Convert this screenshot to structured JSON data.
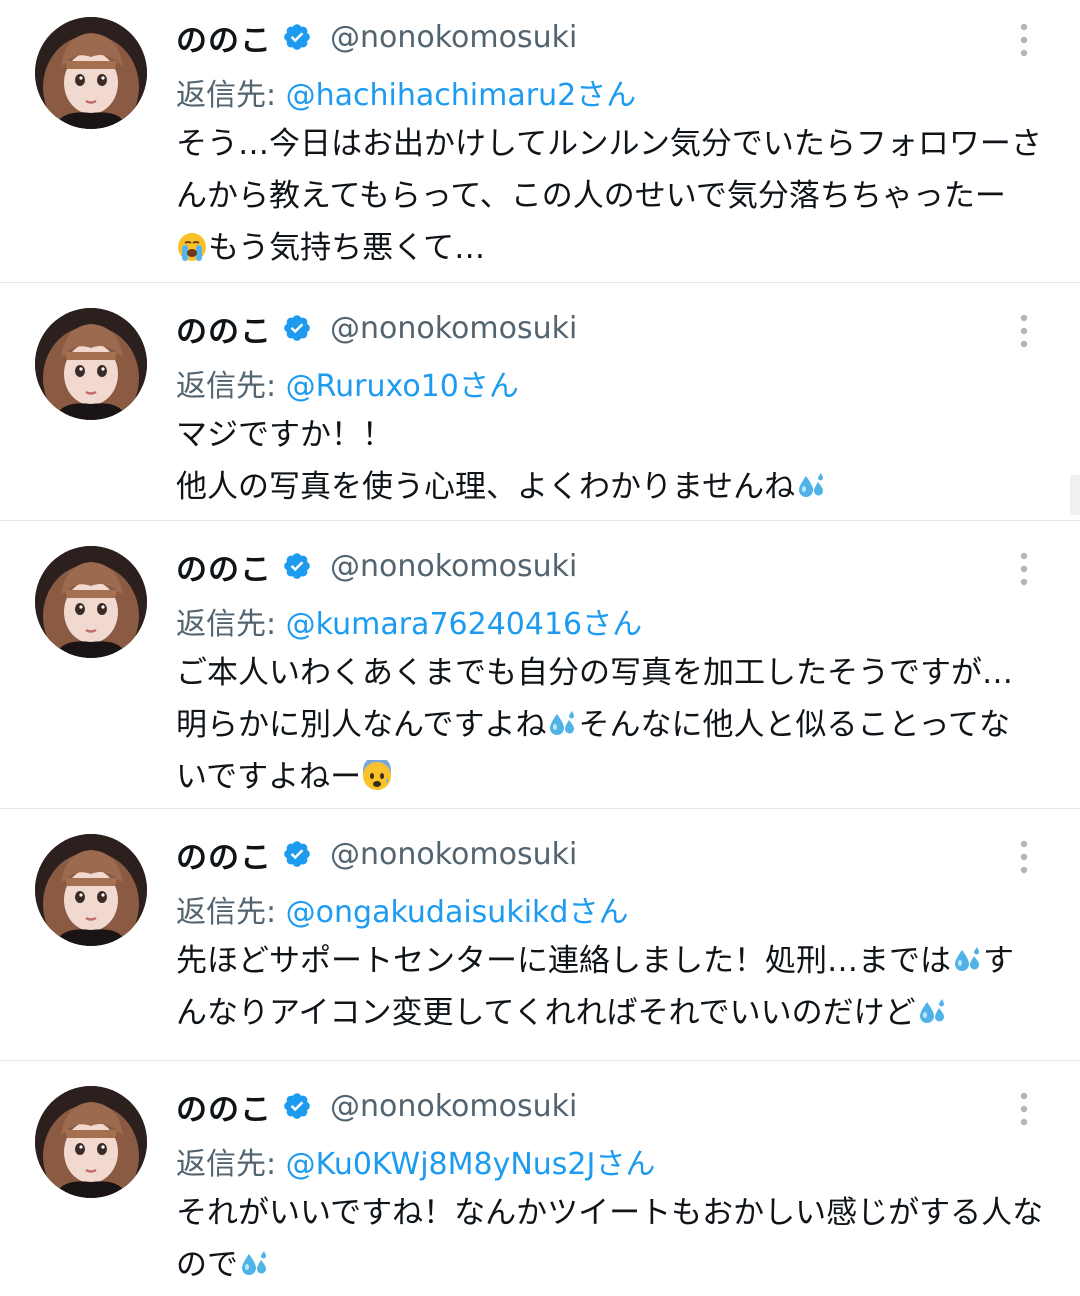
{
  "tweets": [
    {
      "display_name": "ののこ",
      "handle": "@nonokomosuki",
      "reply_prefix": "返信先: ",
      "reply_to": "@hachihachimaru2さん",
      "lines": [
        {
          "text": "そう…今日はお出かけしてルンルン気分でいたらフォロワーさ",
          "emoji": ""
        },
        {
          "text": "んから教えてもらって、この人のせいで気分落ちちゃったー",
          "emoji": ""
        },
        {
          "text": "もう気持ち悪くて…",
          "emoji": "crying-face-emoji",
          "emoji_pos": "start"
        }
      ]
    },
    {
      "display_name": "ののこ",
      "handle": "@nonokomosuki",
      "reply_prefix": "返信先: ",
      "reply_to": "@Ruruxo10さん",
      "lines": [
        {
          "text": "マジですか！！",
          "emoji": ""
        },
        {
          "text": "他人の写真を使う心理、よくわかりませんね",
          "emoji": "sweat-droplets-emoji",
          "emoji_pos": "end"
        }
      ]
    },
    {
      "display_name": "ののこ",
      "handle": "@nonokomosuki",
      "reply_prefix": "返信先: ",
      "reply_to": "@kumara76240416さん",
      "lines": [
        {
          "text": "ご本人いわくあくまでも自分の写真を加工したそうですが…",
          "emoji": ""
        },
        {
          "text": "明らかに別人なんですよね",
          "after": "そんなに他人と似ることってな",
          "emoji": "sweat-droplets-emoji",
          "emoji_pos": "middle"
        },
        {
          "text": "いですよねー",
          "emoji": "anxious-face-emoji",
          "emoji_pos": "end"
        }
      ]
    },
    {
      "display_name": "ののこ",
      "handle": "@nonokomosuki",
      "reply_prefix": "返信先: ",
      "reply_to": "@ongakudaisukikdさん",
      "lines": [
        {
          "text": "先ほどサポートセンターに連絡しました！処刑…までは",
          "after": "す",
          "emoji": "sweat-droplets-emoji",
          "emoji_pos": "middle"
        },
        {
          "text": "んなりアイコン変更してくれればそれでいいのだけど",
          "emoji": "sweat-droplets-emoji",
          "emoji_pos": "end"
        }
      ]
    },
    {
      "display_name": "ののこ",
      "handle": "@nonokomosuki",
      "reply_prefix": "返信先: ",
      "reply_to": "@Ku0KWj8M8yNus2Jさん",
      "lines": [
        {
          "text": "それがいいですね！なんかツイートもおかしい感じがする人な",
          "emoji": ""
        },
        {
          "text": "ので",
          "emoji": "sweat-droplets-emoji",
          "emoji_pos": "end"
        }
      ]
    }
  ],
  "colors": {
    "text": "#0f1419",
    "secondary": "#536471",
    "link": "#1d9bf0",
    "verified": "#1d9bf0",
    "divider": "#e3e6e8"
  },
  "icons": {
    "verified": "verified-badge-icon",
    "more": "more-vertical-icon"
  }
}
